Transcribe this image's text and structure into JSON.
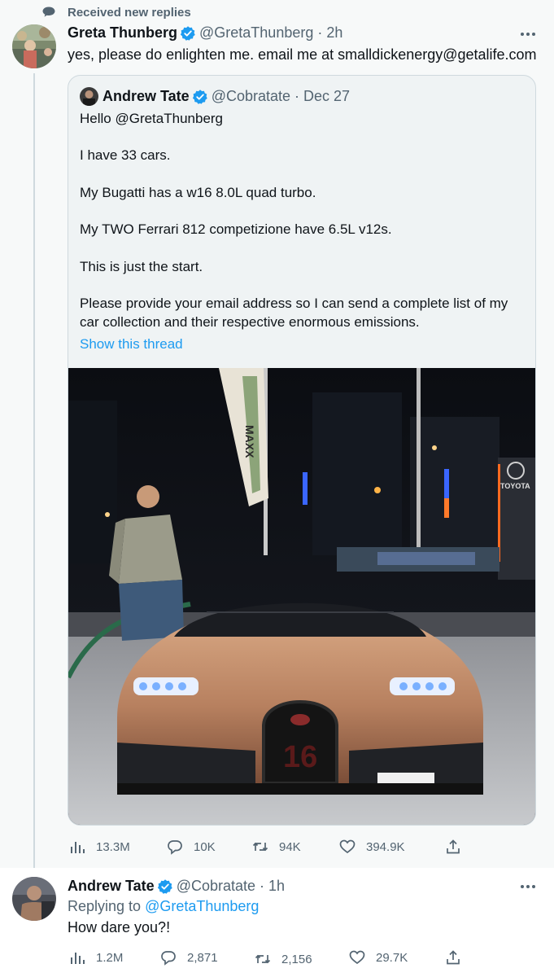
{
  "context": {
    "text": "Received new replies",
    "icon": "chat-bubble-icon"
  },
  "main_tweet": {
    "author_name": "Greta Thunberg",
    "handle": "@GretaThunberg",
    "separator": "·",
    "time": "2h",
    "text": "yes, please do enlighten me. email me at smalldickenergy@getalife.com",
    "quoted": {
      "author_name": "Andrew Tate",
      "handle": "@Cobratate",
      "separator": "·",
      "date": "Dec 27",
      "lines": [
        "Hello @GretaThunberg",
        "I have 33 cars.",
        "My Bugatti has a w16 8.0L quad turbo.",
        "My TWO Ferrari 812 competizione have 6.5L v12s.",
        "This is just the start.",
        "Please provide your email address so I can send a complete list of my",
        "car collection and their respective enormous emissions."
      ],
      "show_thread": "Show this thread",
      "photo_signs": {
        "flag": "MAXX",
        "dealer": "TOYOTA"
      }
    },
    "stats": {
      "views": "13.3M",
      "replies": "10K",
      "retweets": "94K",
      "likes": "394.9K"
    }
  },
  "reply_tweet": {
    "author_name": "Andrew Tate",
    "handle": "@Cobratate",
    "separator": "·",
    "time": "1h",
    "replying_label": "Replying to",
    "replying_to": "@GretaThunberg",
    "text": "How dare you?!",
    "stats": {
      "views": "1.2M",
      "replies": "2,871",
      "retweets": "2,156",
      "likes": "29.7K"
    }
  },
  "colors": {
    "accent": "#1d9bf0",
    "muted": "#536471",
    "border": "#cfd9de",
    "verified": "#1d9bf0"
  }
}
